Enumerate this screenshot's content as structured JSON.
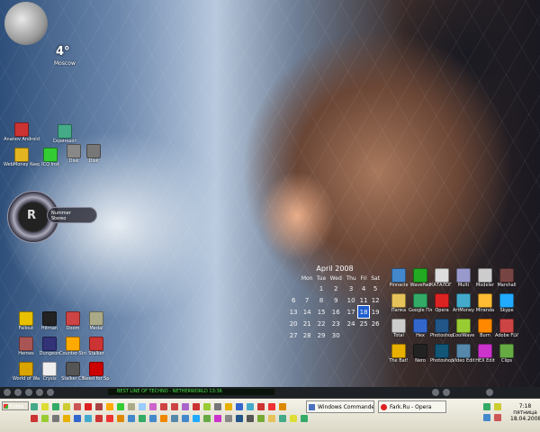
{
  "weather": {
    "temperature": "4°",
    "city": "Moscow"
  },
  "desktop_icons_left": [
    {
      "label": "Ananov Android",
      "color": "#c33"
    },
    {
      "label": "Скриншот",
      "color": "#4a8"
    },
    {
      "label": "WebMoney Keeper",
      "color": "#e3b520"
    },
    {
      "label": "ICQ Inst",
      "color": "#3c3"
    },
    {
      "label": "Disk",
      "color": "#888"
    },
    {
      "label": "Disk",
      "color": "#777"
    }
  ],
  "gadget": {
    "glyph": "R",
    "line1": "Nummer",
    "line2": "Stereo"
  },
  "games_icons": [
    {
      "label": "Fallout",
      "color": "#e8c000"
    },
    {
      "label": "Hitman",
      "color": "#222"
    },
    {
      "label": "Doom",
      "color": "#c44"
    },
    {
      "label": "Medal",
      "color": "#aa8"
    },
    {
      "label": "Heroes",
      "color": "#a55"
    },
    {
      "label": "Dungeon",
      "color": "#337"
    },
    {
      "label": "Counter-Strike",
      "color": "#fa0"
    },
    {
      "label": "Stalker",
      "color": "#c33"
    },
    {
      "label": "World of Warcraft",
      "color": "#d9a400"
    },
    {
      "label": "Crysis",
      "color": "#eee"
    },
    {
      "label": "Stalker CS",
      "color": "#555"
    },
    {
      "label": "Need for Speed",
      "color": "#c00"
    }
  ],
  "calendar": {
    "month_title": "April 2008",
    "weekdays": [
      "Mon",
      "Tue",
      "Wed",
      "Thu",
      "Fri",
      "Sat"
    ],
    "weeks": [
      [
        "",
        "1",
        "2",
        "3",
        "4",
        "5"
      ],
      [
        "7",
        "8",
        "9",
        "10",
        "11",
        "12"
      ],
      [
        "14",
        "15",
        "16",
        "17",
        "18",
        "19"
      ],
      [
        "21",
        "22",
        "23",
        "24",
        "25",
        "26"
      ],
      [
        "28",
        "29",
        "30",
        "",
        "",
        ""
      ]
    ],
    "left_col": [
      "",
      "6",
      "13",
      "20",
      "27"
    ],
    "today": "18"
  },
  "app_icons_right": [
    {
      "label": "Pinnacle",
      "color": "#48c"
    },
    {
      "label": "WavePad",
      "color": "#2a2"
    },
    {
      "label": "КАТАЛОГ ФИЛЬМОВ",
      "color": "#ddd"
    },
    {
      "label": "Multi",
      "color": "#99c"
    },
    {
      "label": "Modeler",
      "color": "#ccc"
    },
    {
      "label": "Marshall",
      "color": "#744"
    },
    {
      "label": "Папка",
      "color": "#e6c25a"
    },
    {
      "label": "Google Планет",
      "color": "#3a6"
    },
    {
      "label": "Opera",
      "color": "#d22"
    },
    {
      "label": "ArtMoney",
      "color": "#4ac"
    },
    {
      "label": "Miranda",
      "color": "#fb3"
    },
    {
      "label": "Skype",
      "color": "#2af"
    },
    {
      "label": "Total",
      "color": "#ccc"
    },
    {
      "label": "Hex",
      "color": "#36c"
    },
    {
      "label": "Photoshop",
      "color": "#258"
    },
    {
      "label": "CoolWave",
      "color": "#9c3"
    },
    {
      "label": "Burn",
      "color": "#f80"
    },
    {
      "label": "Adobe FLV",
      "color": "#c44"
    },
    {
      "label": "The Bat!",
      "color": "#e8b000"
    },
    {
      "label": "Nero",
      "color": "#222"
    },
    {
      "label": "Photoshop 7.0",
      "color": "#157"
    },
    {
      "label": "Video Edit",
      "color": "#58a"
    },
    {
      "label": "HEX Edit",
      "color": "#c3c"
    },
    {
      "label": "Clips",
      "color": "#6a4"
    }
  ],
  "media_bar": {
    "marquee": "BEST LINE OF TECHNO - NETHERWORLD 13:36"
  },
  "taskbar": {
    "start_label": "Кома",
    "tasks": [
      {
        "label": "Windows Commander 5...",
        "kind": "wc"
      },
      {
        "label": "Fark.Ru - Opera",
        "kind": "opera"
      }
    ],
    "clock": {
      "time": "7:18",
      "day": "пятница",
      "date": "18.04.2008"
    }
  },
  "colors": {
    "today_highlight": "#1f5fd0",
    "marquee_text": "#4fe04f",
    "taskbar_bg": "#ece9d8"
  }
}
